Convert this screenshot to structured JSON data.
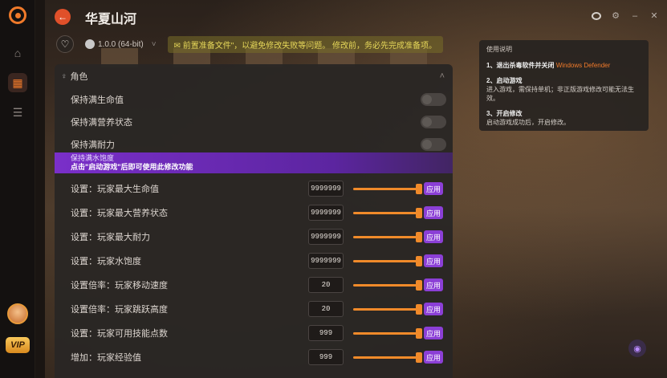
{
  "window": {
    "title": "华夏山河",
    "controls": [
      "theme",
      "settings",
      "minimize",
      "close"
    ]
  },
  "game": {
    "version": "1.0.0 (64-bit)",
    "notice": "前置准备文件\"，以避免修改失败等问题。    修改前，务必先完成准备项。"
  },
  "section": {
    "title": "角色"
  },
  "toggles": [
    {
      "label": "保持满生命值",
      "on": false
    },
    {
      "label": "保持满营养状态",
      "on": false
    },
    {
      "label": "保持满耐力",
      "on": false
    }
  ],
  "tooltip": {
    "item": "保持满水饱度",
    "message": "点击\"启动游戏\"后即可使用此修改功能"
  },
  "settings": [
    {
      "label": "设置：玩家最大生命值",
      "value": "9999999",
      "fill": 0.95
    },
    {
      "label": "设置：玩家最大营养状态",
      "value": "9999999",
      "fill": 0.95
    },
    {
      "label": "设置：玩家最大耐力",
      "value": "9999999",
      "fill": 0.95
    },
    {
      "label": "设置：玩家水饱度",
      "value": "9999999",
      "fill": 0.95
    },
    {
      "label": "设置倍率：玩家移动速度",
      "value": "20",
      "fill": 0.95
    },
    {
      "label": "设置倍率：玩家跳跃高度",
      "value": "20",
      "fill": 0.95
    },
    {
      "label": "设置：玩家可用技能点数",
      "value": "999",
      "fill": 0.95
    },
    {
      "label": "增加：玩家经验值",
      "value": "999",
      "fill": 0.95
    }
  ],
  "apply_label": "应用",
  "usage": {
    "title": "使用说明",
    "step1_title": "1、退出杀毒软件并关闭",
    "step1_highlight": "Windows Defender",
    "step2_title": "2、启动游戏",
    "step2_text": "进入游戏，需保持单机；非正版游戏修改可能无法生效。",
    "step3_title": "3、开启修改",
    "step3_text": "启动游戏成功后，开启修改。"
  },
  "sidebar": {
    "vip_label": "VIP"
  },
  "colors": {
    "accent": "#f07a2a",
    "purple": "#8b3fd6"
  }
}
